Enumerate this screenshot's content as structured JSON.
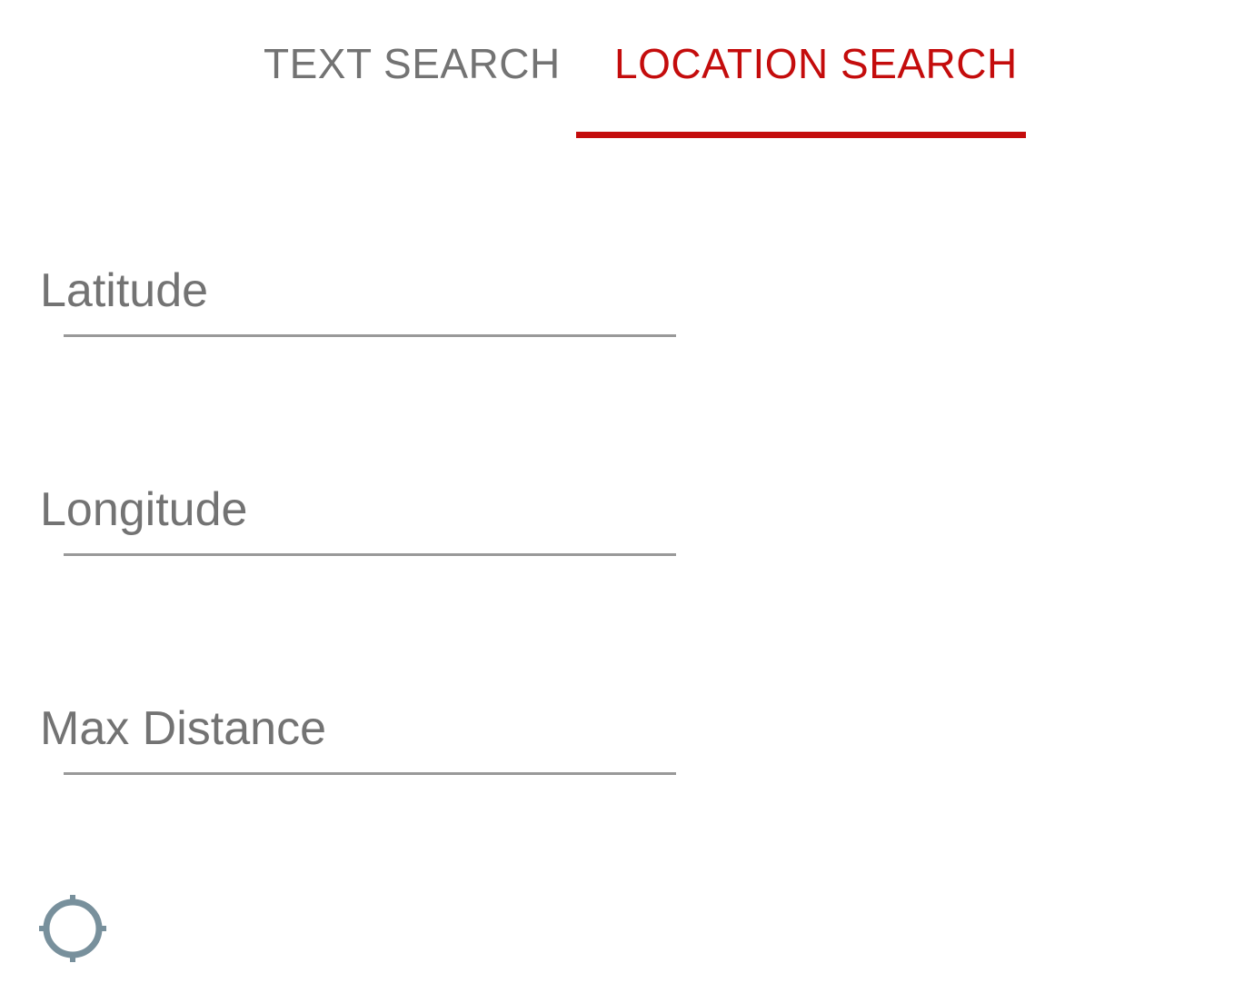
{
  "tabs": {
    "text_search": "TEXT SEARCH",
    "location_search": "LOCATION SEARCH",
    "active": "location_search"
  },
  "fields": {
    "latitude": {
      "label": "Latitude",
      "value": ""
    },
    "longitude": {
      "label": "Longitude",
      "value": ""
    },
    "max_distance": {
      "label": "Max Distance",
      "value": ""
    }
  },
  "icons": {
    "locate": "crosshair-icon"
  },
  "colors": {
    "accent": "#c40c0c",
    "inactive_text": "#737373",
    "underline": "#999999",
    "icon": "#78909c"
  }
}
